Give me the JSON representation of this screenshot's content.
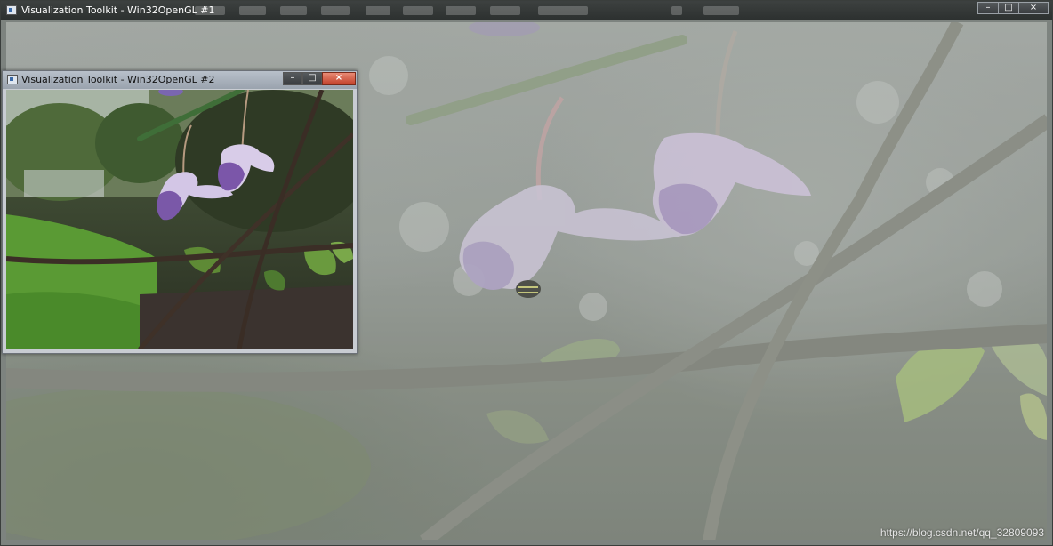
{
  "main_window": {
    "title": "Visualization Toolkit - Win32OpenGL #1",
    "controls": {
      "minimize": "–",
      "maximize": "□",
      "close": "×"
    }
  },
  "secondary_window": {
    "title": "Visualization Toolkit - Win32OpenGL #2",
    "controls": {
      "minimize": "–",
      "maximize": "□",
      "close": "×"
    }
  },
  "icons": {
    "window": "vtk-window-icon",
    "minimize": "minimize-icon",
    "maximize": "maximize-icon",
    "close": "close-icon"
  },
  "colors": {
    "close_button": "#c3412a",
    "title_bar_dark": "#2c302f",
    "title_bar_light": "#9aa3ae"
  },
  "watermark": "https://blog.csdn.net/qq_32809093"
}
